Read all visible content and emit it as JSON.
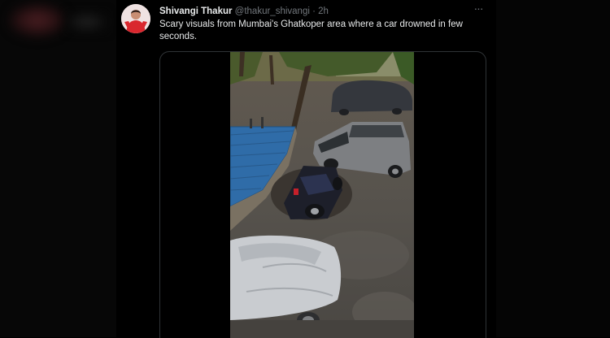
{
  "tweet": {
    "display_name": "Shivangi Thakur",
    "handle": "@thakur_shivangi",
    "separator": "·",
    "time": "2h",
    "more_label": "···",
    "text": "Scary visuals from Mumbai's Ghatkoper area where a car drowned in few seconds."
  },
  "colors": {
    "background": "#000000",
    "text_primary": "#e7e9ea",
    "text_secondary": "#71767b",
    "border": "#2f3336"
  },
  "icons": {
    "more": "more-horizontal-icon"
  }
}
